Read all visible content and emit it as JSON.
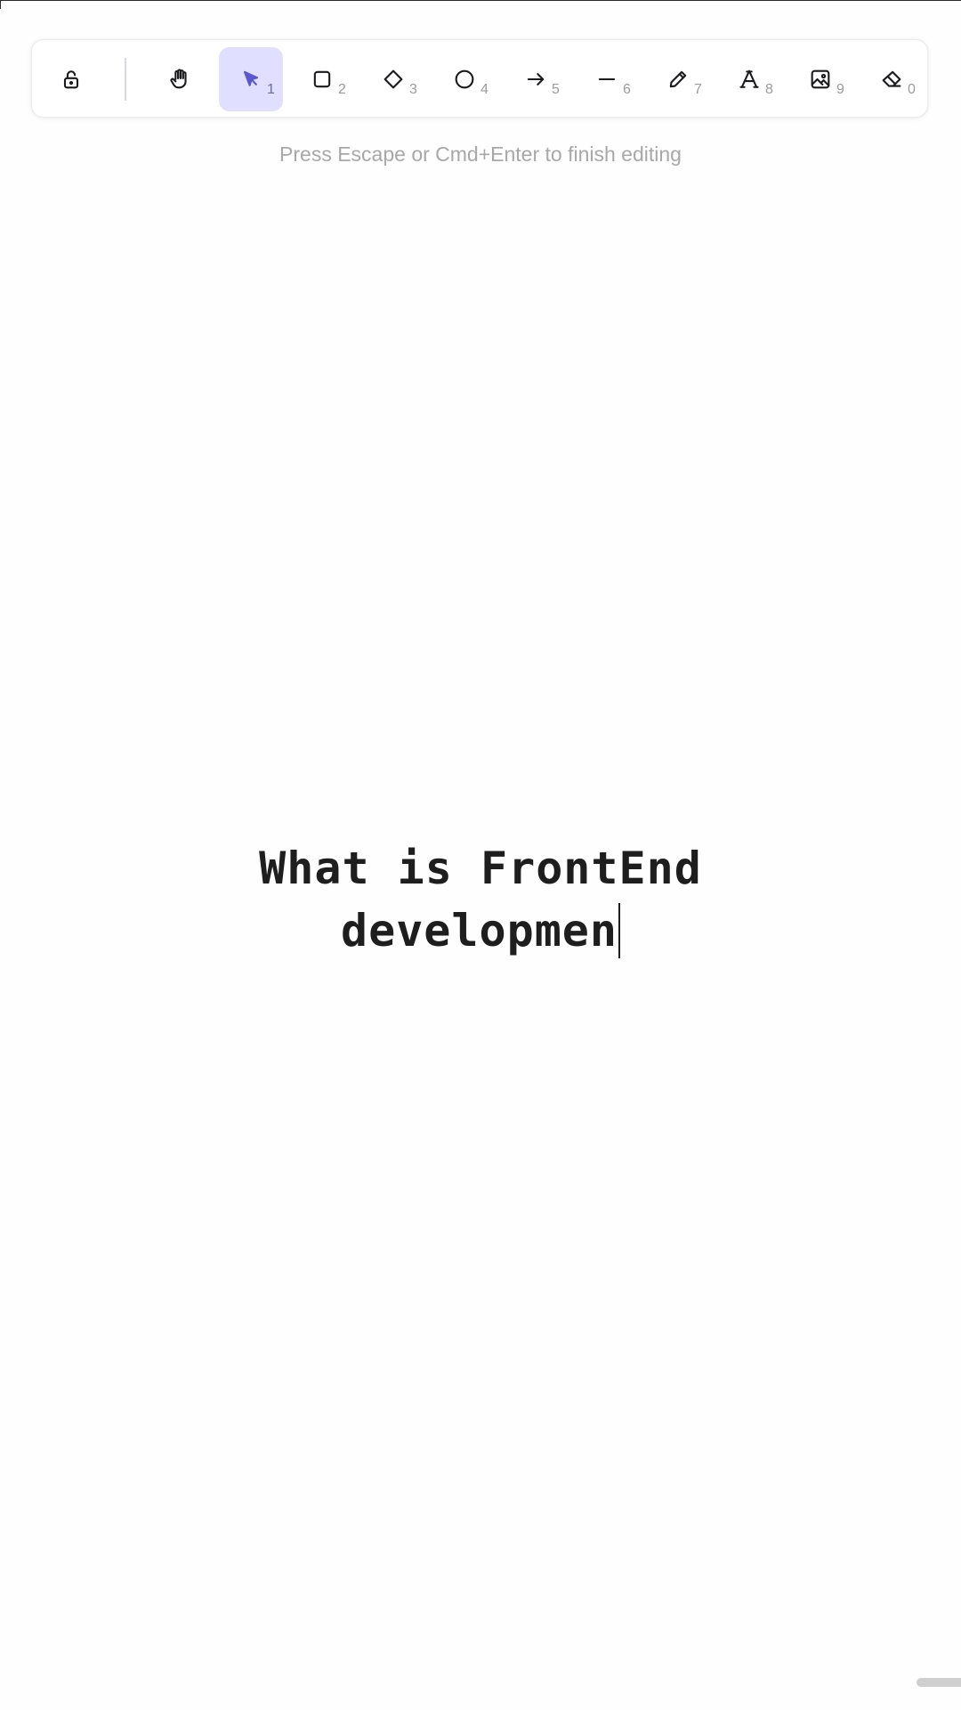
{
  "toolbar": {
    "lock_icon": "unlock-icon",
    "tools": [
      {
        "name": "hand",
        "icon": "hand-icon",
        "shortcut": ""
      },
      {
        "name": "selection",
        "icon": "pointer-icon",
        "shortcut": "1",
        "active": true
      },
      {
        "name": "rectangle",
        "icon": "rectangle-icon",
        "shortcut": "2"
      },
      {
        "name": "diamond",
        "icon": "diamond-icon",
        "shortcut": "3"
      },
      {
        "name": "ellipse",
        "icon": "circle-icon",
        "shortcut": "4"
      },
      {
        "name": "arrow",
        "icon": "arrow-icon",
        "shortcut": "5"
      },
      {
        "name": "line",
        "icon": "line-icon",
        "shortcut": "6"
      },
      {
        "name": "draw",
        "icon": "pencil-icon",
        "shortcut": "7"
      },
      {
        "name": "text",
        "icon": "text-icon",
        "shortcut": "8"
      },
      {
        "name": "image",
        "icon": "image-icon",
        "shortcut": "9"
      },
      {
        "name": "eraser",
        "icon": "eraser-icon",
        "shortcut": "0"
      }
    ],
    "active_color": "#5b57d1",
    "active_background": "#e0dfff"
  },
  "hint": "Press Escape or Cmd+Enter to finish editing",
  "canvas": {
    "text_lines": [
      "What is FrontEnd",
      "developmen"
    ]
  }
}
